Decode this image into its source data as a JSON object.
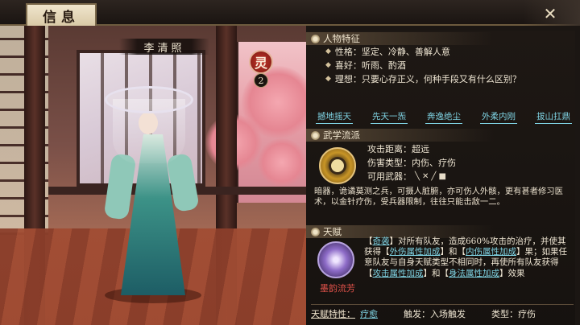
{
  "header": {
    "title": "信息"
  },
  "character": {
    "name": "李清照",
    "spirit_badge": "灵",
    "spirit_count": "2"
  },
  "traits": {
    "heading": "人物特征",
    "items": [
      "性格：坚定、冷静、善解人意",
      "喜好：听雨、酌酒",
      "理想：只要心存正义，何种手段又有什么区别？"
    ]
  },
  "tags": [
    "撼地摇天",
    "先天一炁",
    "奔逸绝尘",
    "外柔内刚",
    "拔山扛鼎"
  ],
  "martial": {
    "heading": "武学流派",
    "range": "攻击距离：超远",
    "damage_type": "伤害类型：内伤、疗伤",
    "weapons_label": "可用武器：",
    "weapon_icons": [
      "needle-icon",
      "dart-icon",
      "blade-icon",
      "box-icon"
    ],
    "description": "暗器，诡谲莫测之兵，可摄人脏腑，亦可伤人外骸，更有甚者修习医术，以金针疗伤，受兵器限制，往往只能击敌一二。"
  },
  "talent": {
    "heading": "天赋",
    "name": "墨韵流芳",
    "text_parts": [
      {
        "t": "【",
        "hl": false
      },
      {
        "t": "奇袭",
        "hl": true
      },
      {
        "t": "】对所有队友，造成660%攻击的治疗，并使其获得【",
        "hl": false
      },
      {
        "t": "外伤属性加成",
        "hl": true
      },
      {
        "t": "】和【",
        "hl": false
      },
      {
        "t": "内伤属性加成",
        "hl": true
      },
      {
        "t": "】果；如果任意队友与自身天赋类型不相同时，再使所有队友获得【",
        "hl": false
      },
      {
        "t": "攻击属性加成",
        "hl": true
      },
      {
        "t": "】和【",
        "hl": false
      },
      {
        "t": "身法属性加成",
        "hl": true
      },
      {
        "t": "】效果",
        "hl": false
      }
    ],
    "trait_label": "天赋特性：",
    "trait_value": "疗愈",
    "trigger": "触发：入场触发",
    "type": "类型：疗伤"
  },
  "colors": {
    "accent_link": "#7fd3e3",
    "talent_name": "#e0524a",
    "panel_bg": "#1e1814"
  }
}
